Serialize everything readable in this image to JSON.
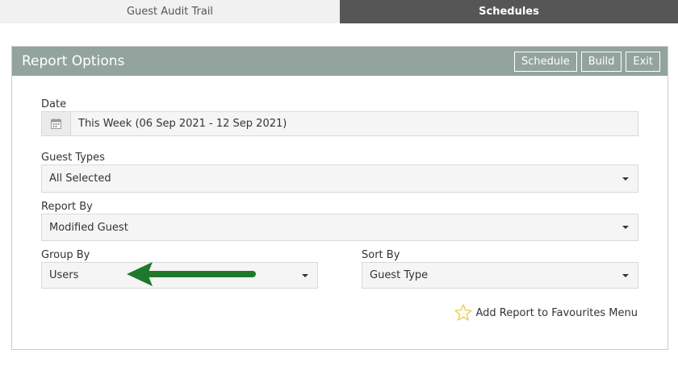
{
  "tabs": [
    {
      "label": "Guest Audit Trail",
      "active": false
    },
    {
      "label": "Schedules",
      "active": true
    }
  ],
  "panel": {
    "title": "Report Options",
    "buttons": {
      "schedule": "Schedule",
      "build": "Build",
      "exit": "Exit"
    }
  },
  "fields": {
    "date": {
      "label": "Date",
      "value": "This Week (06 Sep 2021 - 12 Sep 2021)",
      "icon": "calendar-icon"
    },
    "guest_types": {
      "label": "Guest Types",
      "value": "All Selected"
    },
    "report_by": {
      "label": "Report By",
      "value": "Modified Guest"
    },
    "group_by": {
      "label": "Group By",
      "value": "Users"
    },
    "sort_by": {
      "label": "Sort By",
      "value": "Guest Type"
    }
  },
  "favourites": {
    "label": "Add Report to Favourites Menu",
    "icon": "star-outline-icon"
  },
  "colors": {
    "header": "#93a49e",
    "active_tab": "#565656",
    "arrow": "#1e7a2a",
    "star": "#e8c84a"
  }
}
